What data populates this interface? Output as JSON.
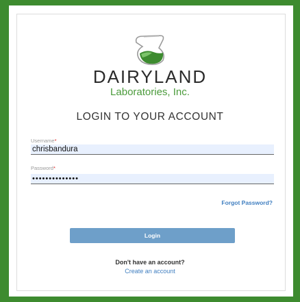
{
  "brand": {
    "name": "DAIRYLAND",
    "subtitle": "Laboratories, Inc.",
    "accent_color": "#3d8b2f",
    "icon": "flask-icon"
  },
  "login": {
    "heading": "LOGIN TO YOUR ACCOUNT",
    "username": {
      "label": "Username",
      "required_mark": "*",
      "value": "chrisbandura"
    },
    "password": {
      "label": "Password",
      "required_mark": "*",
      "value": "••••••••••••••"
    },
    "forgot_label": "Forgot Password?",
    "login_label": "Login",
    "no_account_text": "Don't have an account?",
    "create_label": "Create an account"
  },
  "colors": {
    "border_green": "#3d8b2f",
    "button_blue": "#6e9fc9",
    "link_blue": "#3f7ec0",
    "required_red": "#e02424",
    "input_bg": "#e8f0fe"
  }
}
